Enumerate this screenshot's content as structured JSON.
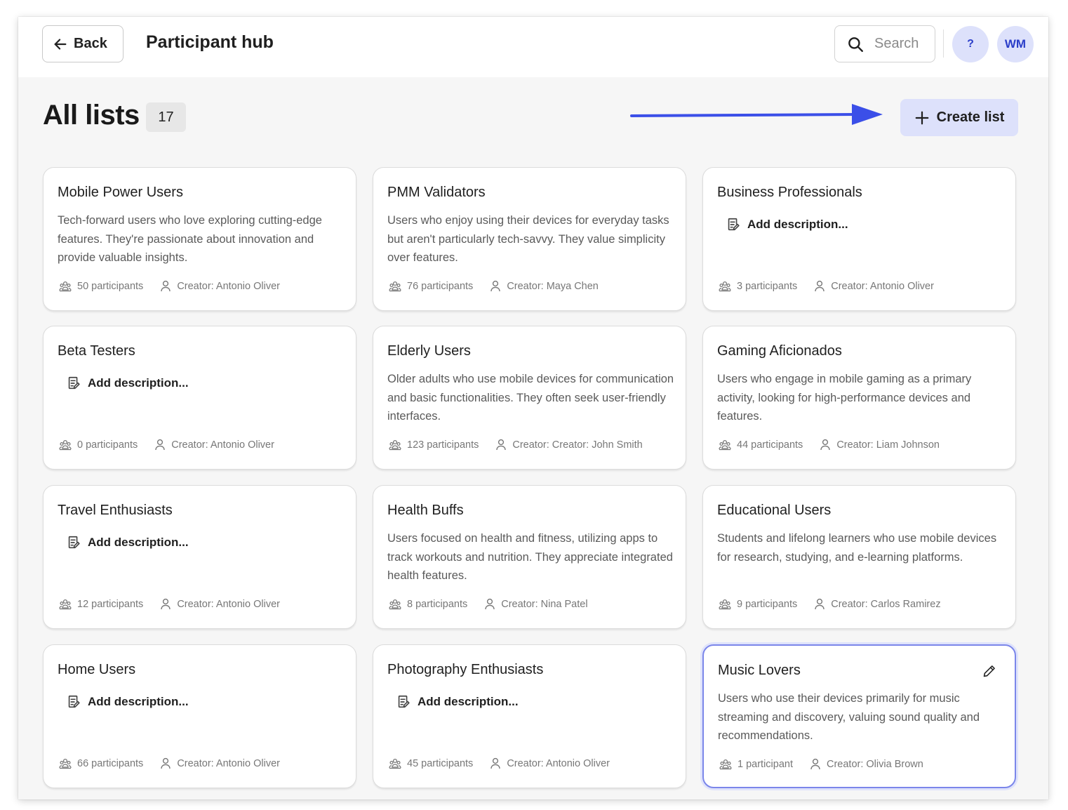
{
  "header": {
    "back_label": "Back",
    "title": "Participant hub",
    "search_placeholder": "Search",
    "help_label": "?",
    "avatar_initials": "WM"
  },
  "main": {
    "heading": "All lists",
    "count": "17",
    "create_label": "Create list",
    "add_description_label": "Add description..."
  },
  "colors": {
    "accent": "#3b4fe8",
    "accent_soft": "#dde1fb",
    "selected_border": "#7b86ea"
  },
  "cards": [
    {
      "title": "Mobile Power Users",
      "description": "Tech-forward users who love exploring cutting-edge features. They're passionate about innovation and provide valuable insights.",
      "participants": "50 participants",
      "creator": "Creator: Antonio Oliver"
    },
    {
      "title": "PMM Validators",
      "description": "Users who enjoy using their devices for everyday tasks but aren't particularly tech-savvy. They value simplicity over features.",
      "participants": "76 participants",
      "creator": "Creator: Maya Chen"
    },
    {
      "title": "Business Professionals",
      "description": "",
      "participants": "3 participants",
      "creator": "Creator: Antonio Oliver"
    },
    {
      "title": "Beta Testers",
      "description": "",
      "participants": "0 participants",
      "creator": "Creator: Antonio Oliver"
    },
    {
      "title": "Elderly Users",
      "description": "Older adults who use mobile devices for communication and basic functionalities. They often seek user-friendly interfaces.",
      "participants": "123 participants",
      "creator": "Creator: Creator: John Smith"
    },
    {
      "title": "Gaming Aficionados",
      "description": "Users who engage in mobile gaming as a primary activity, looking for high-performance devices and features.",
      "participants": "44 participants",
      "creator": "Creator: Liam Johnson"
    },
    {
      "title": "Travel Enthusiasts",
      "description": "",
      "participants": "12 participants",
      "creator": "Creator: Antonio Oliver"
    },
    {
      "title": "Health Buffs",
      "description": "Users focused on health and fitness, utilizing apps to track workouts and nutrition. They appreciate integrated health features.",
      "participants": "8 participants",
      "creator": "Creator: Nina Patel"
    },
    {
      "title": "Educational Users",
      "description": "Students and lifelong learners who use mobile devices for research, studying, and e-learning platforms.",
      "participants": "9 participants",
      "creator": "Creator: Carlos Ramirez"
    },
    {
      "title": "Home Users",
      "description": "",
      "participants": "66 participants",
      "creator": "Creator: Antonio Oliver"
    },
    {
      "title": "Photography Enthusiasts",
      "description": "",
      "participants": "45 participants",
      "creator": "Creator: Antonio Oliver"
    },
    {
      "title": "Music Lovers",
      "description": "Users who use their devices primarily for music streaming and discovery, valuing sound quality and recommendations.",
      "participants": "1 participant",
      "creator": "Creator: Olivia Brown",
      "selected": true
    }
  ]
}
